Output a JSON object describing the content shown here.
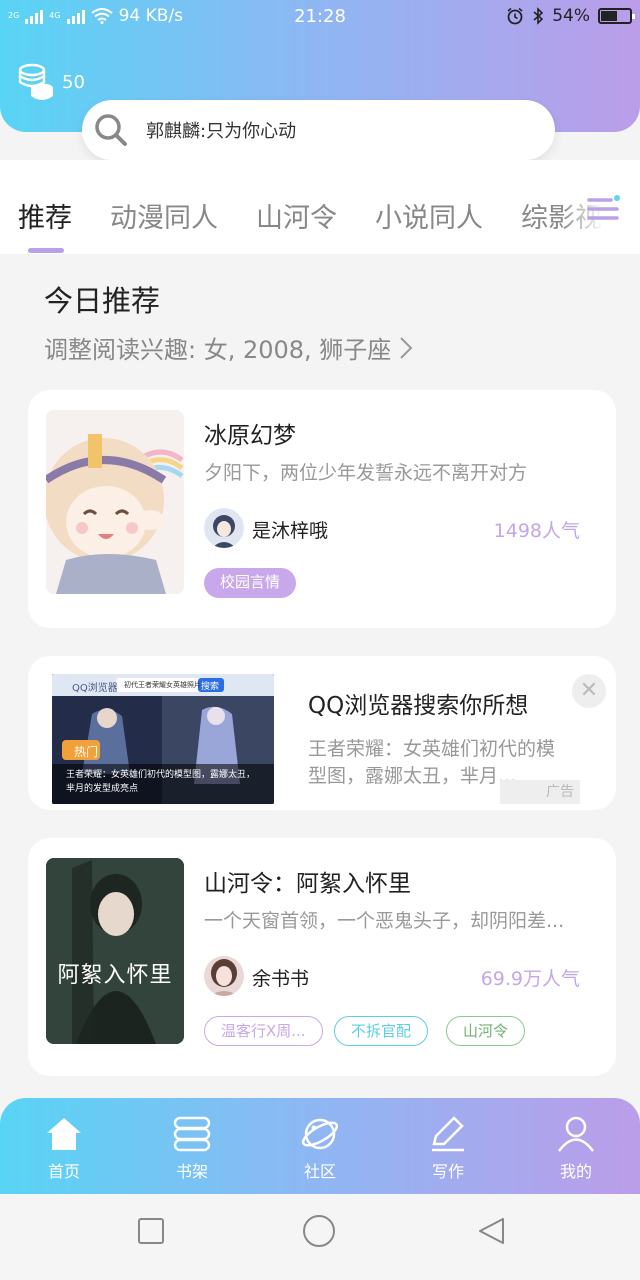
{
  "status_bar": {
    "network_1": "2G",
    "network_2": "4G",
    "speed": "94 KB/s",
    "time": "21:28",
    "battery": "54%"
  },
  "header": {
    "coin_count": "50",
    "search_placeholder": "郭麒麟:只为你心动"
  },
  "tabs": [
    "推荐",
    "动漫同人",
    "山河令",
    "小说同人",
    "综影视"
  ],
  "section": {
    "title": "今日推荐",
    "subtitle": "调整阅读兴趣: 女, 2008, 狮子座"
  },
  "books": [
    {
      "title": "冰原幻梦",
      "desc": "夕阳下，两位少年发誓永远不离开对方",
      "author": "是沐梓哦",
      "popularity": "1498人气",
      "tags": [
        "校园言情"
      ]
    },
    {
      "title": "山河令：阿絮入怀里",
      "desc": "一个天窗首领，一个恶鬼头子，却阴阳差...",
      "author": "余书书",
      "popularity": "69.9万人气",
      "tags": [
        "温客行X周...",
        "不拆官配",
        "山河令"
      ]
    }
  ],
  "ad": {
    "title": "QQ浏览器搜索你所想",
    "desc": "王者荣耀：女英雄们初代的模型图，露娜太丑，芈月...",
    "label": "广告",
    "close": "✕",
    "image": {
      "logo": "QQ浏览器",
      "query": "初代王者荣耀女英雄照片",
      "button": "搜索",
      "hot": "热门",
      "caption": "王者荣耀：女英雄们初代的模型图，露娜太丑，芈月的发型成亮点"
    }
  },
  "cover_text": {
    "book2": "阿絮入怀里"
  },
  "bottom_nav": [
    "首页",
    "书架",
    "社区",
    "写作",
    "我的"
  ],
  "colors": {
    "accent_purple": "#b9a0ea",
    "header_start": "#58d4f4",
    "header_end": "#bb9de9"
  }
}
